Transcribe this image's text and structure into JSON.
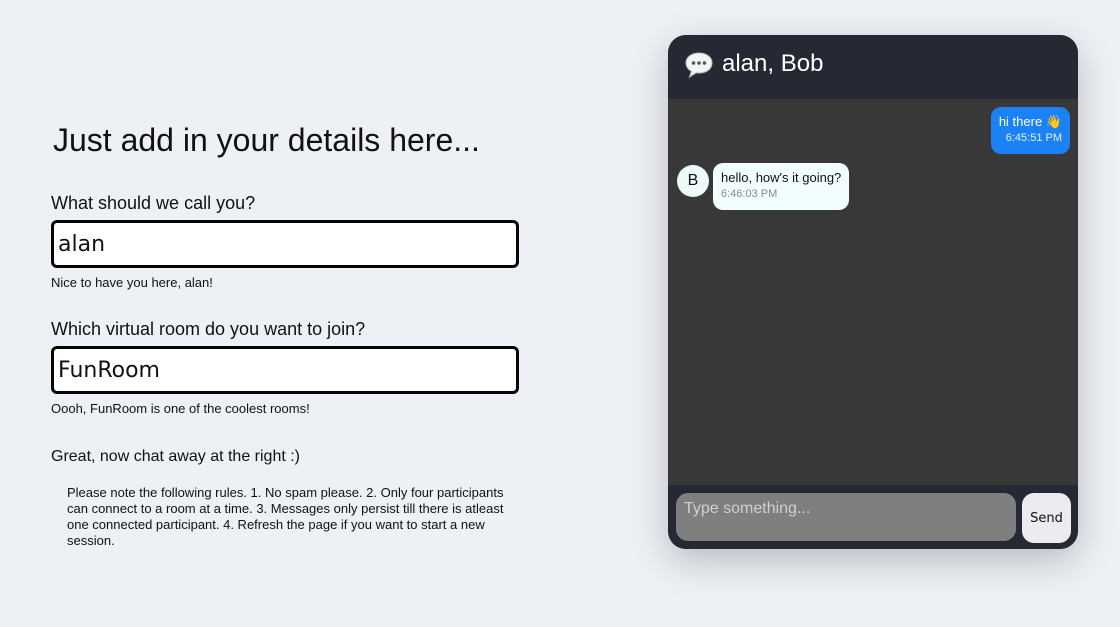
{
  "form": {
    "title": "Just add in your details here...",
    "name_label": "What should we call you?",
    "name_value": "alan",
    "name_helper": "Nice to have you here, alan!",
    "room_label": "Which virtual room do you want to join?",
    "room_value": "FunRoom",
    "room_helper": "Oooh, FunRoom is one of the coolest rooms!",
    "chat_prompt": "Great, now chat away at the right :)",
    "rules": "Please note the following rules. 1. No spam please. 2. Only four participants can connect to a room at a time. 3. Messages only persist till there is atleast one connected participant. 4. Refresh the page if you want to start a new session."
  },
  "chat": {
    "header_icon": "speech-bubble-icon",
    "title": "alan, Bob",
    "messages": [
      {
        "direction": "sent",
        "text": "hi there 👋",
        "time": "6:45:51 PM"
      },
      {
        "direction": "received",
        "avatar": "B",
        "text": "hello, how's it going?",
        "time": "6:46:03 PM"
      }
    ],
    "composer": {
      "placeholder": "Type something...",
      "send_label": "Send"
    }
  },
  "colors": {
    "page_background": "#edf0f5",
    "chat_header": "#252934",
    "chat_body": "#383838",
    "sent_bubble": "#1a82f4",
    "received_bubble": "#f2fdfd",
    "composer_input": "#7f7f7f",
    "send_button": "#ececf0"
  }
}
